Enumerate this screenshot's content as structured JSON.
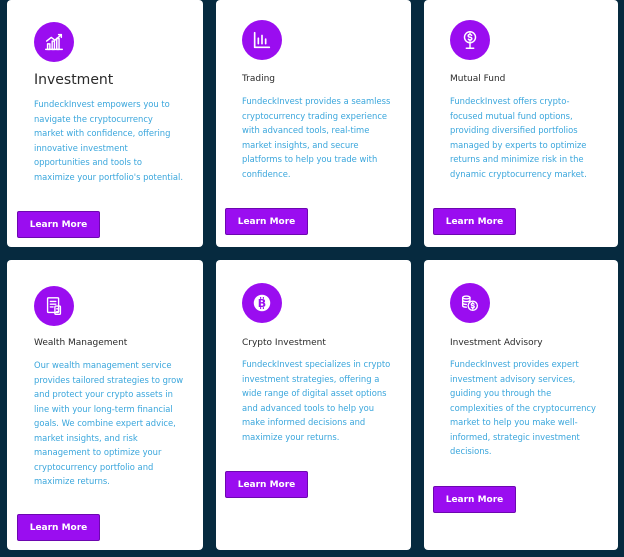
{
  "cards": [
    {
      "title": "Investment",
      "icon": "growth-chart-icon",
      "description": "FundeckInvest empowers you to navigate the cryptocurrency market with confidence, offering innovative investment opportunities and tools to maximize your portfolio's potential.",
      "button_label": "Learn More"
    },
    {
      "title": "Trading",
      "icon": "bar-chart-icon",
      "description": "FundeckInvest provides a seamless cryptocurrency trading experience with advanced tools, real-time market insights, and secure platforms to help you trade with confidence.",
      "button_label": "Learn More"
    },
    {
      "title": "Mutual Fund",
      "icon": "money-bag-icon",
      "description": "FundeckInvest offers crypto-focused mutual fund options, providing diversified portfolios managed by experts to optimize returns and minimize risk in the dynamic cryptocurrency market.",
      "button_label": "Learn More"
    },
    {
      "title": "Wealth Management",
      "icon": "document-report-icon",
      "description": "Our wealth management service provides tailored strategies to grow and protect your crypto assets in line with your long-term financial goals. We combine expert advice, market insights, and risk management to optimize your cryptocurrency portfolio and maximize returns.",
      "button_label": "Learn More"
    },
    {
      "title": "Crypto Investment",
      "icon": "bitcoin-icon",
      "description": "FundeckInvest specializes in crypto investment strategies, offering a wide range of digital asset options and advanced tools to help you make informed decisions and maximize your returns.",
      "button_label": "Learn More"
    },
    {
      "title": "Investment Advisory",
      "icon": "coin-stack-icon",
      "description": "FundeckInvest provides expert investment advisory services, guiding you through the complexities of the cryptocurrency market to help you make well-informed, strategic investment decisions.",
      "button_label": "Learn More"
    }
  ],
  "colors": {
    "page_background": "#062a3f",
    "card_background": "#ffffff",
    "accent_purple": "#9a0df0",
    "description_blue": "#3aa6dc",
    "title_dark": "#2a2a2a"
  }
}
